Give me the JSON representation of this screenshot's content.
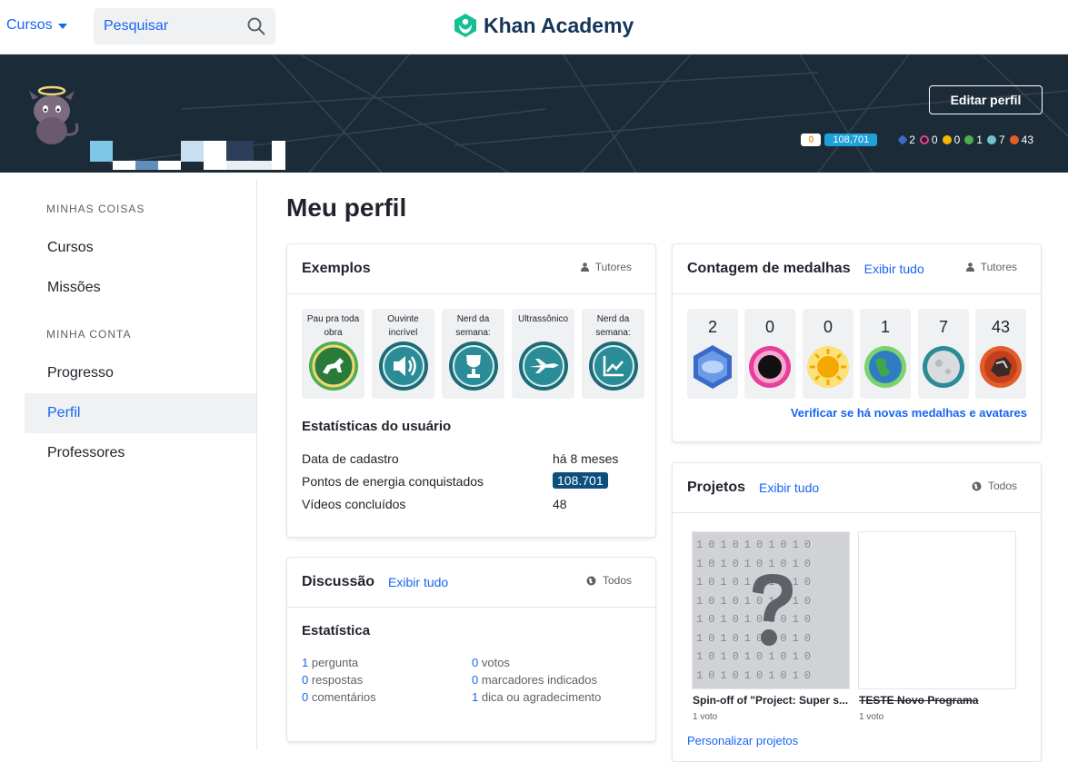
{
  "nav": {
    "courses_label": "Cursos",
    "search_placeholder": "Pesquisar",
    "logo_text": "Khan Academy"
  },
  "banner": {
    "edit_button": "Editar perfil",
    "streak": "0",
    "energy_points": "108,701",
    "badge_counts": [
      {
        "icon": "meteorite-badge-icon",
        "count": "2",
        "color": "#3b6ac8"
      },
      {
        "icon": "black-hole-badge-icon",
        "count": "0",
        "color": "#e83f9b"
      },
      {
        "icon": "sun-badge-icon",
        "count": "0",
        "color": "#f5b800"
      },
      {
        "icon": "earth-badge-icon",
        "count": "1",
        "color": "#4cae4c"
      },
      {
        "icon": "moon-badge-icon",
        "count": "7",
        "color": "#6fc2cf"
      },
      {
        "icon": "challenge-patch-icon",
        "count": "43",
        "color": "#e35d2a"
      }
    ]
  },
  "sidebar": {
    "section1": "MINHAS COISAS",
    "items1": [
      "Cursos",
      "Missões"
    ],
    "section2": "MINHA CONTA",
    "items2": [
      "Progresso",
      "Perfil",
      "Professores"
    ]
  },
  "main": {
    "title": "Meu perfil"
  },
  "exemplos": {
    "title": "Exemplos",
    "visibility": "Tutores",
    "badges": [
      {
        "label": "Pau pra toda obra",
        "icon": "horse-badge-icon"
      },
      {
        "label": "Ouvinte incrível",
        "icon": "speaker-badge-icon"
      },
      {
        "label": "Nerd da semana: domi...",
        "icon": "trophy-badge-icon"
      },
      {
        "label": "Ultrassônico",
        "icon": "jet-badge-icon"
      },
      {
        "label": "Nerd da semana: prática",
        "icon": "chart-badge-icon"
      }
    ],
    "stats_title": "Estatísticas do usuário",
    "stats": [
      {
        "label": "Data de cadastro",
        "value": "há 8 meses"
      },
      {
        "label": "Pontos de energia conquistados",
        "value": "108.701"
      },
      {
        "label": "Vídeos concluídos",
        "value": "48"
      }
    ]
  },
  "medalhas": {
    "title": "Contagem de medalhas",
    "link": "Exibir tudo",
    "visibility": "Tutores",
    "counts": [
      "2",
      "0",
      "0",
      "1",
      "7",
      "43"
    ],
    "check_link": "Verificar se há novas medalhas e avatares"
  },
  "discussao": {
    "title": "Discussão",
    "link": "Exibir tudo",
    "visibility": "Todos",
    "subtitle": "Estatística",
    "left": [
      {
        "n": "1",
        "label": " pergunta"
      },
      {
        "n": "0",
        "label": " respostas"
      },
      {
        "n": "0",
        "label": " comentários"
      }
    ],
    "right": [
      {
        "n": "0",
        "label": " votos"
      },
      {
        "n": "0",
        "label": " marcadores indicados"
      },
      {
        "n": "1",
        "label": " dica ou agradecimento"
      }
    ]
  },
  "projetos": {
    "title": "Projetos",
    "link": "Exibir tudo",
    "visibility": "Todos",
    "items": [
      {
        "title": "Spin-off of \"Project: Super s...",
        "votes": "1 voto"
      },
      {
        "title": "TESTE Novo Programa",
        "votes": "1 voto"
      }
    ],
    "customize_link": "Personalizar projetos"
  }
}
